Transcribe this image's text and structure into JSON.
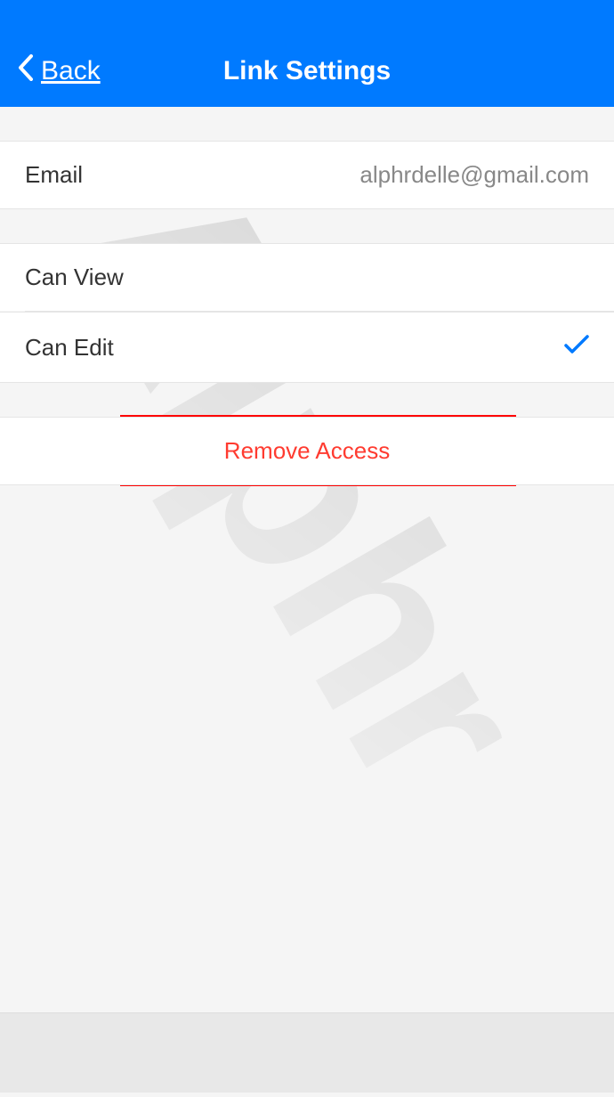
{
  "header": {
    "back_label": "Back",
    "title": "Link Settings"
  },
  "email_row": {
    "label": "Email",
    "value": "alphrdelle@gmail.com"
  },
  "permissions": {
    "can_view_label": "Can View",
    "can_view_selected": false,
    "can_edit_label": "Can Edit",
    "can_edit_selected": true
  },
  "remove_button_label": "Remove Access",
  "watermark_text": "Alphr"
}
